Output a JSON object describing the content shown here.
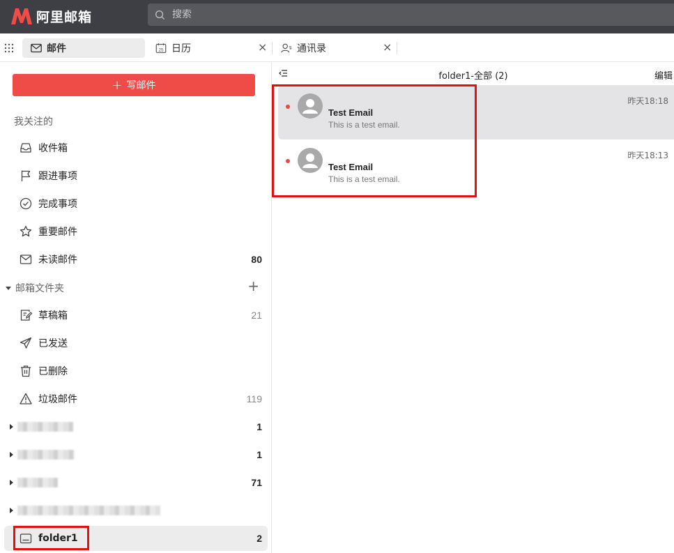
{
  "app": {
    "title": "阿里邮箱",
    "search_placeholder": "搜索"
  },
  "tabs": [
    {
      "label": "邮件",
      "icon": "mail-icon",
      "active": true
    },
    {
      "label": "日历",
      "icon": "calendar-icon",
      "calendar_day": "25",
      "active": false
    },
    {
      "label": "通讯录",
      "icon": "contacts-icon",
      "active": false
    }
  ],
  "tab_close": "×",
  "sidebar": {
    "compose_label": "写邮件",
    "compose_plus": "+",
    "favorites_label": "我关注的",
    "favorites": [
      {
        "label": "收件箱",
        "icon": "inbox-icon",
        "count": ""
      },
      {
        "label": "跟进事项",
        "icon": "flag-icon",
        "count": ""
      },
      {
        "label": "完成事项",
        "icon": "check-circle-icon",
        "count": ""
      },
      {
        "label": "重要邮件",
        "icon": "star-icon",
        "count": ""
      },
      {
        "label": "未读邮件",
        "icon": "mail-icon",
        "count": "80"
      }
    ],
    "folders_label": "邮箱文件夹",
    "folders_add": "+",
    "folders": [
      {
        "label": "草稿箱",
        "icon": "draft-icon",
        "count": "21"
      },
      {
        "label": "已发送",
        "icon": "send-icon",
        "count": ""
      },
      {
        "label": "已删除",
        "icon": "trash-icon",
        "count": ""
      },
      {
        "label": "垃圾邮件",
        "icon": "warning-icon",
        "count": "119"
      }
    ],
    "hidden_folders": [
      {
        "count": "1"
      },
      {
        "count": "1"
      },
      {
        "count": "71"
      },
      {
        "count": ""
      }
    ],
    "selected_folder": {
      "label": "folder1",
      "icon": "folder-icon",
      "count": "2"
    }
  },
  "main": {
    "title": "folder1-全部 (2)",
    "edit_label": "编辑",
    "emails": [
      {
        "sender": "Test Email",
        "preview": "This is a test email.",
        "time": "昨天18:18",
        "unread": true
      },
      {
        "sender": "Test Email",
        "preview": "This is a test email.",
        "time": "昨天18:13",
        "unread": true
      }
    ]
  },
  "colors": {
    "topbar": "#3d3f44",
    "accent": "#ef4b47",
    "highlight": "#e0110f",
    "unread_dot": "#e8483f"
  }
}
